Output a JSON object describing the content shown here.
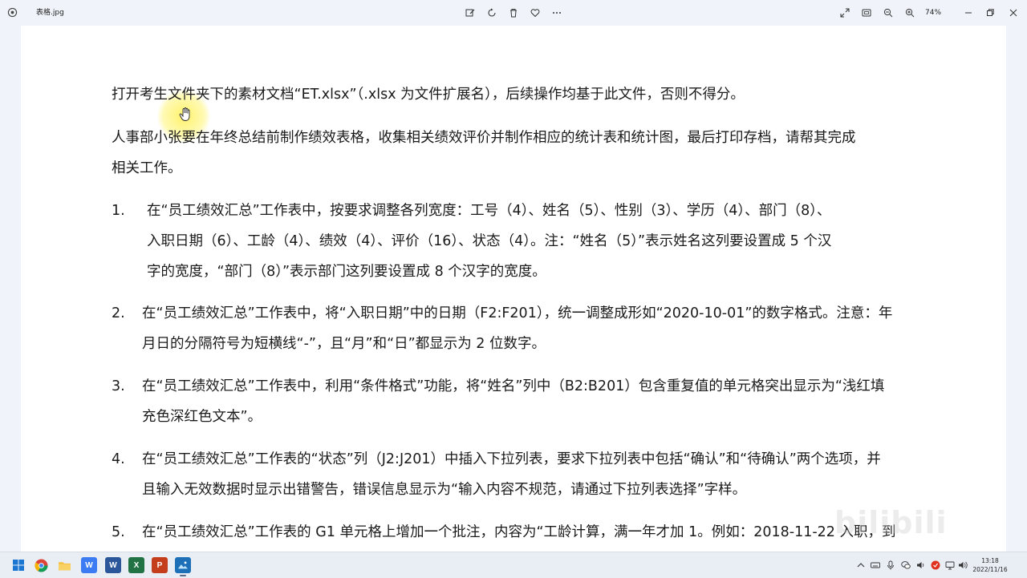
{
  "titlebar": {
    "file_name": "表格.jpg",
    "zoom": "74%",
    "icons": [
      "edit-icon",
      "rotate-icon",
      "delete-icon",
      "heart-icon",
      "more-icon",
      "expand-icon",
      "fit-icon",
      "zoom-out-icon",
      "zoom-in-icon",
      "minimize-icon",
      "maximize-icon",
      "close-icon"
    ]
  },
  "document": {
    "intro": "打开考生文件夹下的素材文档“ET.xlsx”（.xlsx 为文件扩展名），后续操作均基于此文件，否则不得分。",
    "desc_line1": "人事部小张要在年终总结前制作绩效表格，收集相关绩效评价并制作相应的统计表和统计图，最后打印存档，请帮其完成",
    "desc_line2": "相关工作。",
    "items": [
      {
        "num": "1.",
        "lines": [
          "在“员工绩效汇总”工作表中，按要求调整各列宽度：工号（4）、姓名（5）、性别（3）、学历（4）、部门（8）、",
          "入职日期（6）、工龄（4）、绩效（4）、评价（16）、状态（4）。注：“姓名（5）”表示姓名这列要设置成 5 个汉",
          "字的宽度，“部门（8）”表示部门这列要设置成 8 个汉字的宽度。"
        ]
      },
      {
        "num": "2.",
        "lines": [
          "在“员工绩效汇总”工作表中，将“入职日期”中的日期（F2:F201），统一调整成形如“2020-10-01”的数字格式。注意：年",
          "月日的分隔符号为短横线“-”，且“月”和“日”都显示为 2 位数字。"
        ]
      },
      {
        "num": "3.",
        "lines": [
          "在“员工绩效汇总”工作表中，利用“条件格式”功能，将“姓名”列中（B2:B201）包含重复值的单元格突出显示为“浅红填",
          "充色深红色文本”。"
        ]
      },
      {
        "num": "4.",
        "lines": [
          "在“员工绩效汇总”工作表的“状态”列（J2:J201）中插入下拉列表，要求下拉列表中包括“确认”和“待确认”两个选项，并",
          "且输入无效数据时显示出错警告，错误信息显示为“输入内容不规范，请通过下拉列表选择”字样。"
        ]
      },
      {
        "num": "5.",
        "lines": [
          "在“员工绩效汇总”工作表的 G1 单元格上增加一个批注，内容为“工龄计算，满一年才加 1。例如：2018-11-22 入职，到"
        ]
      }
    ]
  },
  "taskbar": {
    "apps": [
      {
        "name": "start-icon"
      },
      {
        "name": "chrome-icon"
      },
      {
        "name": "file-explorer-icon"
      },
      {
        "name": "wps-writer-icon",
        "label": "W"
      },
      {
        "name": "word-icon",
        "label": "W"
      },
      {
        "name": "excel-icon",
        "label": "X"
      },
      {
        "name": "powerpoint-icon",
        "label": "P"
      },
      {
        "name": "photos-icon"
      }
    ],
    "clock": {
      "time": "13:18",
      "date": "2022/11/16"
    },
    "colors": {
      "word": "#2b579a",
      "excel": "#217346",
      "ppt": "#c43e1c",
      "wps": "#3b7cf5",
      "chrome_red": "#db4437",
      "folder": "#f5c242",
      "photos": "#1d6fb8"
    }
  },
  "watermark": "bilibili"
}
